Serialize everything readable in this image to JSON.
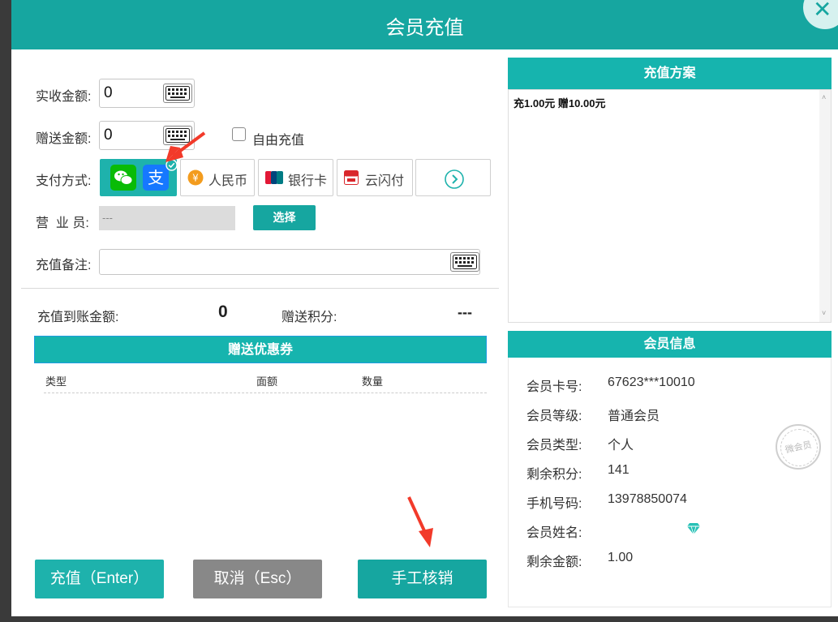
{
  "dialog": {
    "title": "会员充值"
  },
  "form": {
    "actual_label": "实收金额:",
    "actual_value": "0",
    "gift_label": "赠送金额:",
    "gift_value": "0",
    "free_recharge_label": "自由充值",
    "pay_label": "支付方式:",
    "pay_methods": [
      {
        "label": "微信/支付宝",
        "selected": true
      },
      {
        "label": "人民币"
      },
      {
        "label": "银行卡"
      },
      {
        "label": "云闪付"
      }
    ],
    "clerk_label": "营  业 员:",
    "clerk_value": "---",
    "select_button": "选择",
    "remark_label": "充值备注:",
    "remark_value": ""
  },
  "summary": {
    "balance_label": "充值到账金额:",
    "balance_value": "0",
    "points_label": "赠送积分:",
    "points_value": "---"
  },
  "coupon": {
    "header": "赠送优惠券",
    "columns": [
      "类型",
      "面额",
      "数量"
    ]
  },
  "buttons": {
    "recharge": "充值（Enter）",
    "cancel": "取消（Esc）",
    "manual": "手工核销"
  },
  "plan": {
    "header": "充值方案",
    "items": [
      "充1.00元 赠10.00元"
    ]
  },
  "member": {
    "header": "会员信息",
    "rows": [
      {
        "key": "会员卡号:",
        "value": "67623***10010"
      },
      {
        "key": "会员等级:",
        "value": "普通会员"
      },
      {
        "key": "会员类型:",
        "value": "个人"
      },
      {
        "key": "剩余积分:",
        "value": "141"
      },
      {
        "key": "手机号码:",
        "value": "13978850074"
      },
      {
        "key": "会员姓名:",
        "value": ""
      },
      {
        "key": "剩余金额:",
        "value": "1.00"
      }
    ],
    "stamp_text": "微会员"
  },
  "colors": {
    "accent": "#16a6a0",
    "cancel": "#888888",
    "annotation": "#f23a2a"
  }
}
